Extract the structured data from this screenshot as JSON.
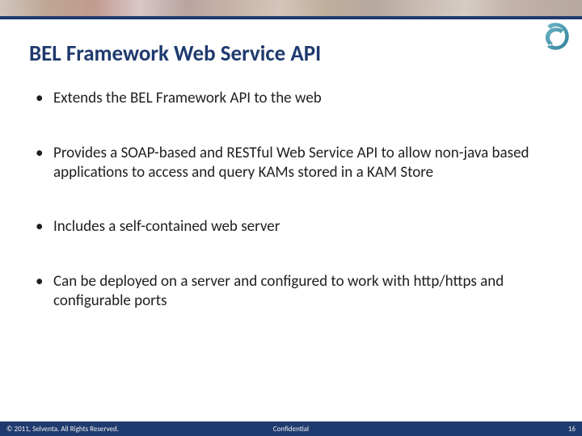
{
  "title": "BEL Framework Web Service API",
  "bullets": [
    "Extends the BEL Framework API to the web",
    "Provides a SOAP-based and RESTful Web Service API to allow non-java based applications to access and query KAMs stored in a KAM Store",
    "Includes a self-contained web server",
    "Can be deployed on a server and configured to work with http/https and configurable ports"
  ],
  "footer": {
    "copyright": "© 2011, Selventa. All Rights Reserved.",
    "classification": "Confidential",
    "page": "16"
  },
  "colors": {
    "accent": "#1f3a6e",
    "logo": "#3b8fa8"
  }
}
